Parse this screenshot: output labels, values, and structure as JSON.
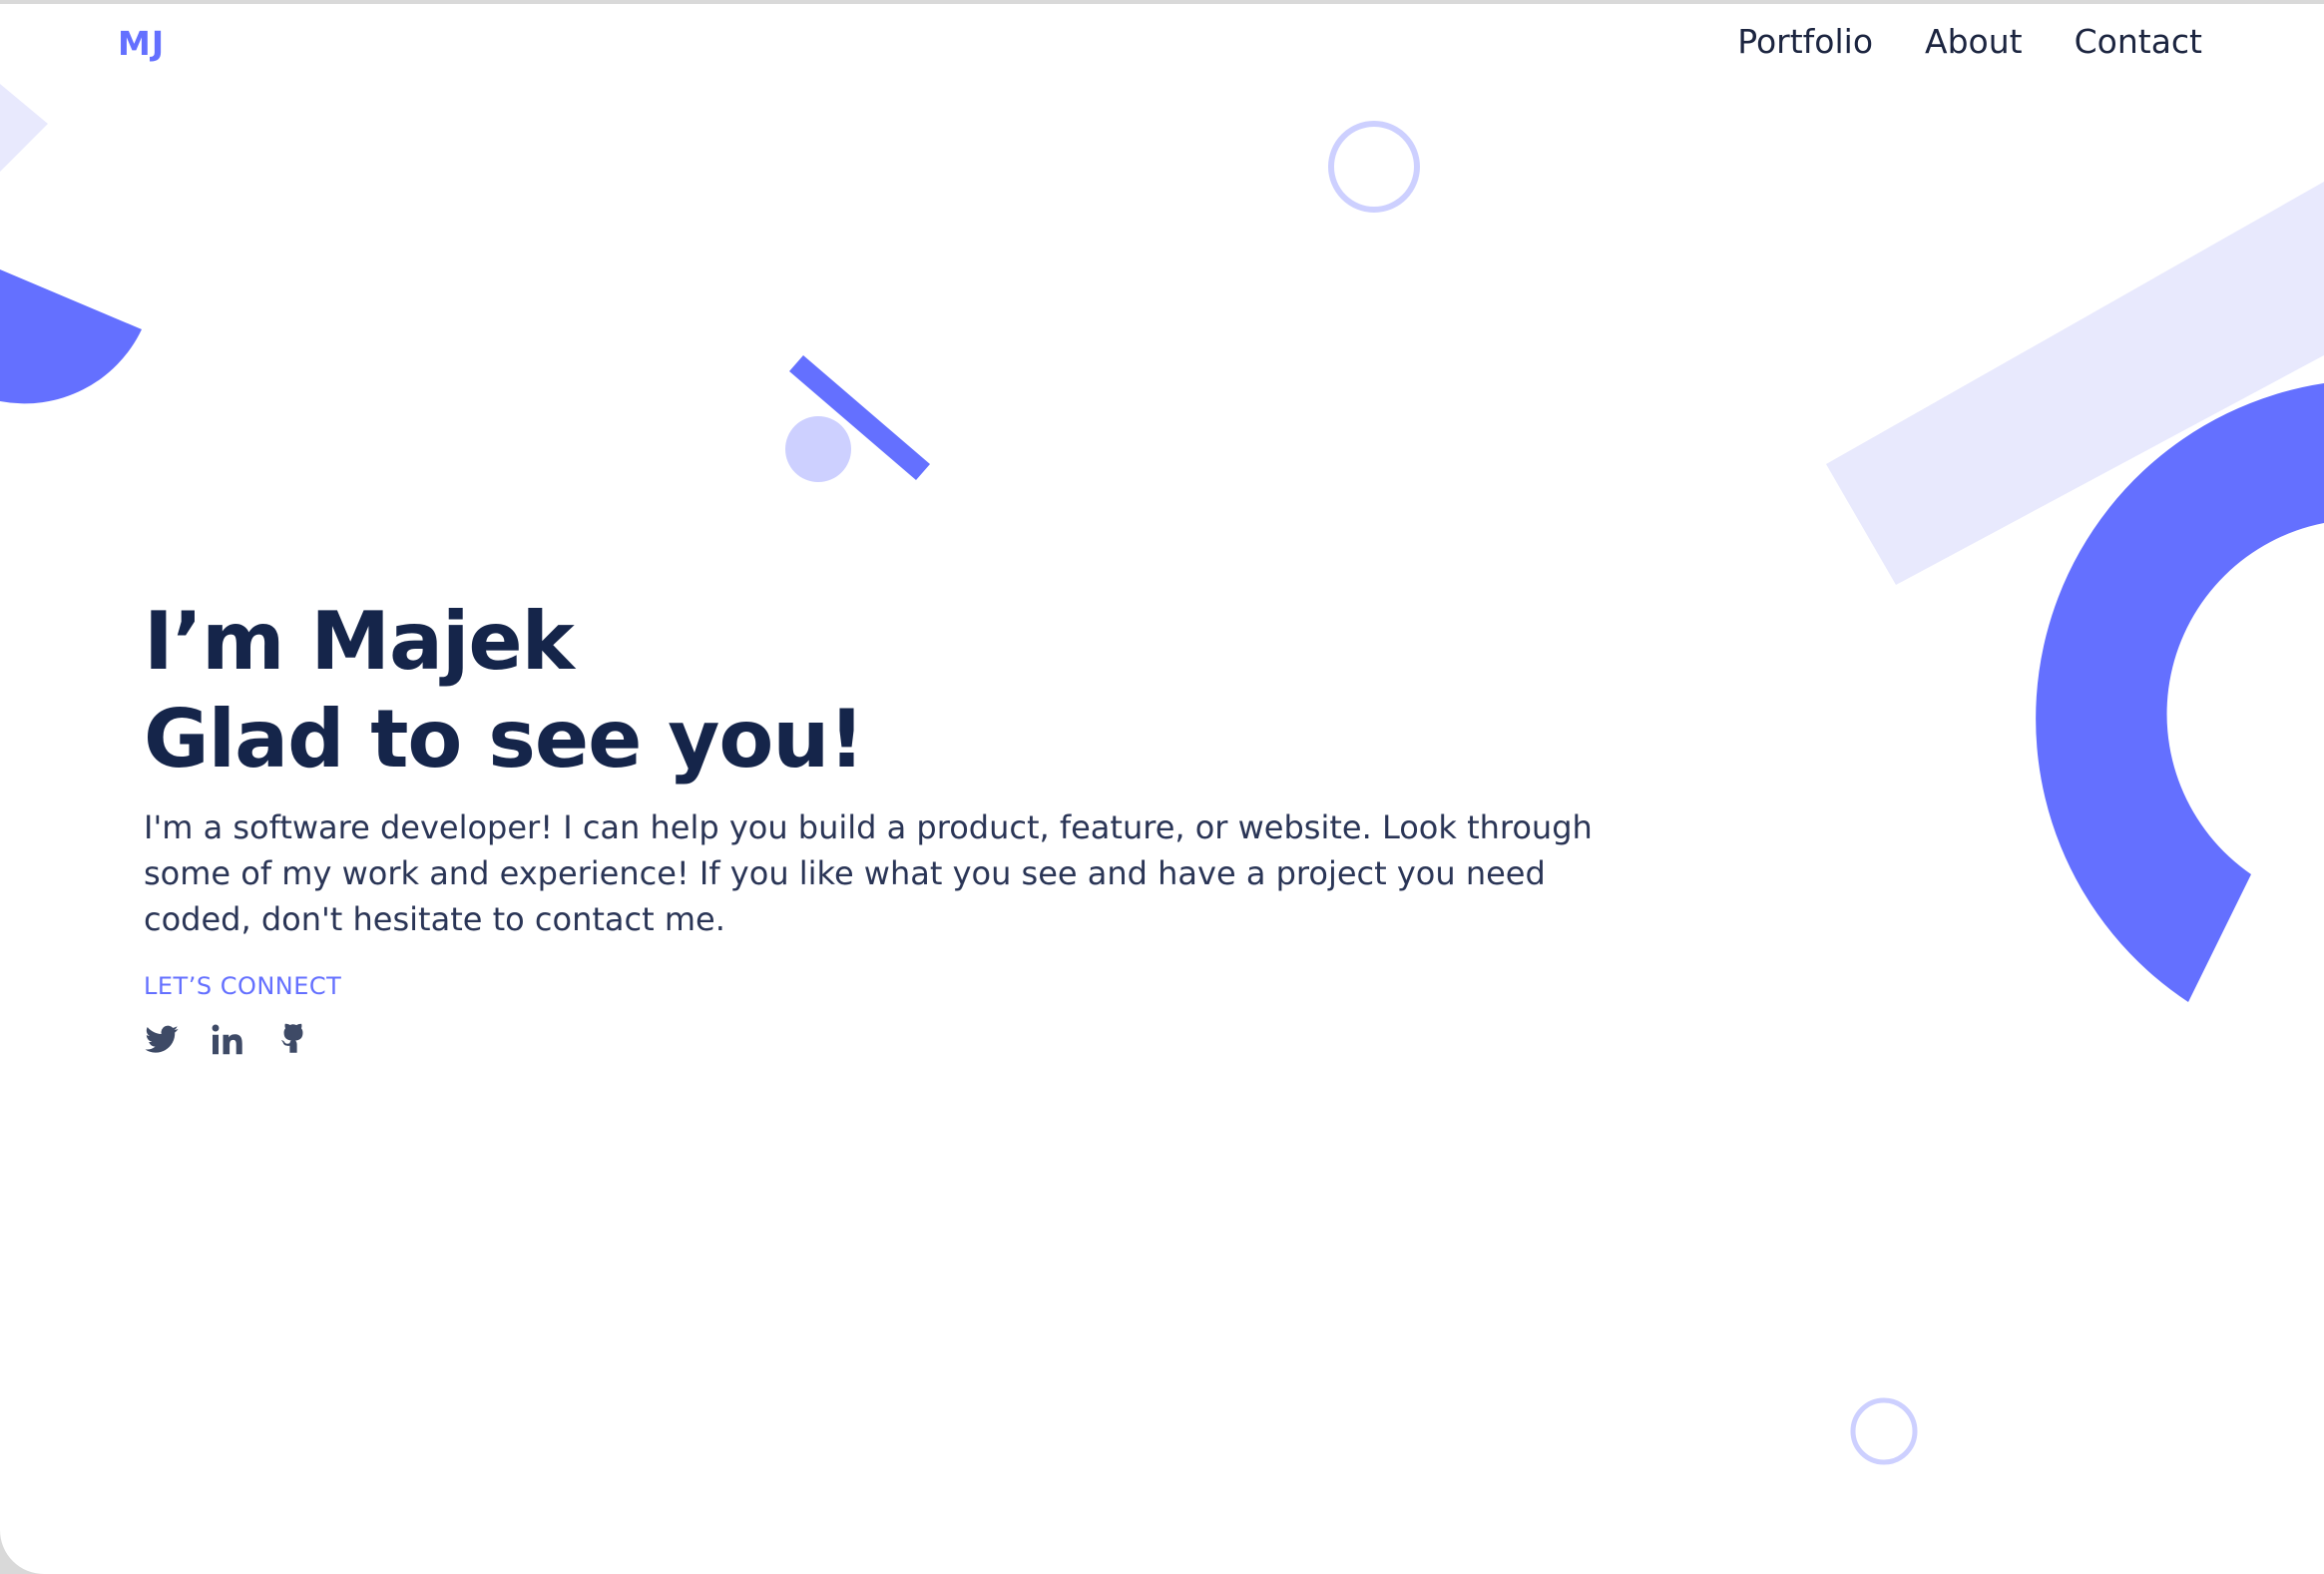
{
  "header": {
    "logo": "MJ",
    "nav": [
      "Portfolio",
      "About",
      "Contact"
    ]
  },
  "hero": {
    "title_line1": "I’m Majek",
    "title_line2": "Glad to see you!",
    "intro": "I'm a software developer! I can help you build a product, feature, or website. Look through some of my work and experience! If you like what you see and have a project you need coded, don't hesitate to contact me.",
    "connect_label": "LET’S CONNECT"
  },
  "social": [
    "twitter-icon",
    "linkedin-icon",
    "github-icon"
  ],
  "colors": {
    "accent": "#6470ff",
    "accent_light": "#cdd0ff",
    "accent_pale": "#e8e9fd",
    "heading": "#15254a",
    "text": "#2a3556"
  }
}
